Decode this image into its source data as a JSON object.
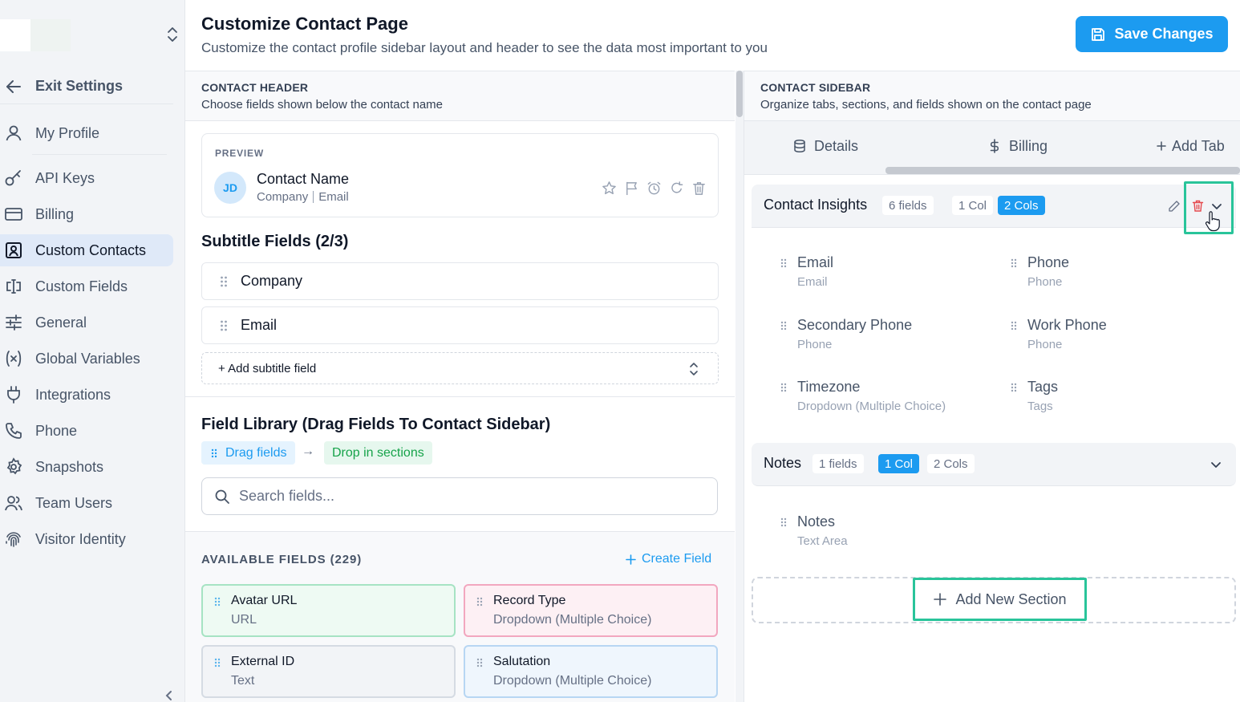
{
  "sidebar": {
    "exit_label": "Exit Settings",
    "items": [
      {
        "label": "My Profile",
        "icon": "user-icon"
      },
      {
        "label": "API Keys",
        "icon": "key-icon"
      },
      {
        "label": "Billing",
        "icon": "credit-card-icon"
      },
      {
        "label": "Custom Contacts",
        "icon": "contact-card-icon",
        "active": true
      },
      {
        "label": "Custom Fields",
        "icon": "text-cursor-icon"
      },
      {
        "label": "General",
        "icon": "sliders-icon"
      },
      {
        "label": "Global Variables",
        "icon": "variable-icon"
      },
      {
        "label": "Integrations",
        "icon": "plug-icon"
      },
      {
        "label": "Phone",
        "icon": "phone-icon"
      },
      {
        "label": "Snapshots",
        "icon": "gear-icon"
      },
      {
        "label": "Team Users",
        "icon": "users-icon"
      },
      {
        "label": "Visitor Identity",
        "icon": "fingerprint-icon"
      }
    ]
  },
  "header": {
    "title": "Customize Contact Page",
    "subtitle": "Customize the contact profile sidebar layout and header to see the data most important to you",
    "save_label": "Save Changes"
  },
  "contact_header": {
    "heading": "CONTACT HEADER",
    "description": "Choose fields shown below the contact name",
    "preview_label": "PREVIEW",
    "avatar_initials": "JD",
    "contact_name": "Contact Name",
    "meta_company": "Company",
    "meta_email": "Email",
    "subtitle_heading": "Subtitle Fields (2/3)",
    "subtitle_fields": [
      "Company",
      "Email"
    ],
    "add_subtitle_label": "+ Add subtitle field"
  },
  "library": {
    "heading": "Field Library (Drag Fields To Contact Sidebar)",
    "drag_label": "Drag fields",
    "arrow": "→",
    "drop_label": "Drop in sections",
    "search_placeholder": "Search fields...",
    "available_label": "AVAILABLE FIELDS (229)",
    "create_label": "Create Field",
    "fields": [
      {
        "name": "Avatar URL",
        "type": "URL"
      },
      {
        "name": "Record Type",
        "type": "Dropdown (Multiple Choice)"
      },
      {
        "name": "External ID",
        "type": "Text"
      },
      {
        "name": "Salutation",
        "type": "Dropdown (Multiple Choice)"
      }
    ]
  },
  "contact_sidebar": {
    "heading": "CONTACT SIDEBAR",
    "description": "Organize tabs, sections, and fields shown on the contact page",
    "tabs": [
      {
        "label": "Details",
        "icon": "database-icon"
      },
      {
        "label": "Billing",
        "icon": "dollar-icon"
      },
      {
        "label": "Add Tab",
        "icon": "plus-icon"
      }
    ],
    "sections": [
      {
        "title": "Contact Insights",
        "count": "6 fields",
        "col1": "1 Col",
        "col2": "2 Cols",
        "layout": "2 Cols",
        "fields": [
          {
            "name": "Email",
            "type": "Email"
          },
          {
            "name": "Phone",
            "type": "Phone"
          },
          {
            "name": "Secondary Phone",
            "type": "Phone"
          },
          {
            "name": "Work Phone",
            "type": "Phone"
          },
          {
            "name": "Timezone",
            "type": "Dropdown (Multiple Choice)"
          },
          {
            "name": "Tags",
            "type": "Tags"
          }
        ]
      },
      {
        "title": "Notes",
        "count": "1 fields",
        "col1": "1 Col",
        "col2": "2 Cols",
        "layout": "1 Col",
        "fields": [
          {
            "name": "Notes",
            "type": "Text Area"
          }
        ]
      }
    ],
    "add_section_label": "Add New Section"
  },
  "colors": {
    "accent": "#1c9bf0",
    "highlight": "#29c49a",
    "danger": "#e5484d",
    "success": "#16a34a"
  }
}
